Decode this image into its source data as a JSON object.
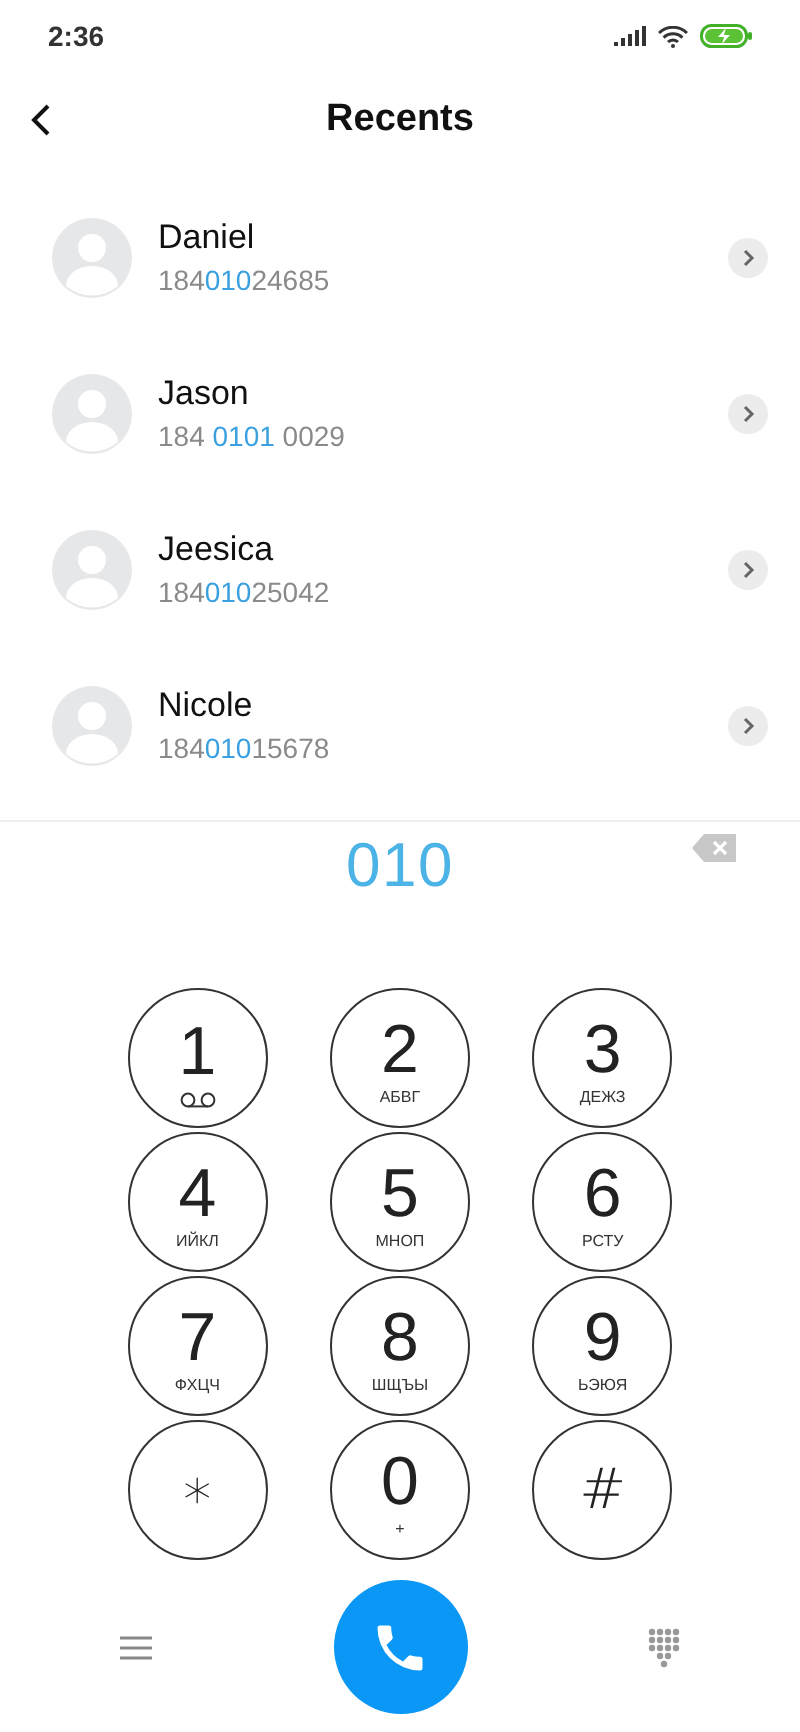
{
  "status_bar": {
    "time": "2:36"
  },
  "header": {
    "title": "Recents"
  },
  "contacts": [
    {
      "name": "Daniel",
      "number": [
        {
          "text": "184",
          "match": false
        },
        {
          "text": "010",
          "match": true
        },
        {
          "text": "24685",
          "match": false
        }
      ]
    },
    {
      "name": "Jason",
      "number": [
        {
          "text": "184 ",
          "match": false
        },
        {
          "text": "0101",
          "match": true
        },
        {
          "text": " 0029",
          "match": false
        }
      ]
    },
    {
      "name": "Jeesica",
      "number": [
        {
          "text": "184",
          "match": false
        },
        {
          "text": "010",
          "match": true
        },
        {
          "text": "25042",
          "match": false
        }
      ]
    },
    {
      "name": "Nicole",
      "number": [
        {
          "text": "184",
          "match": false
        },
        {
          "text": "010",
          "match": true
        },
        {
          "text": "15678",
          "match": false
        }
      ]
    }
  ],
  "dial_input": {
    "value": "010"
  },
  "keypad": [
    {
      "kind": "voicemail",
      "key": "1"
    },
    {
      "kind": "letters",
      "key": "2",
      "sub": "АБВГ"
    },
    {
      "kind": "letters",
      "key": "3",
      "sub": "ДЕЖЗ"
    },
    {
      "kind": "letters",
      "key": "4",
      "sub": "ИЙКЛ"
    },
    {
      "kind": "letters",
      "key": "5",
      "sub": "МНОП"
    },
    {
      "kind": "letters",
      "key": "6",
      "sub": "РСТУ"
    },
    {
      "kind": "letters",
      "key": "7",
      "sub": "ФХЦЧ"
    },
    {
      "kind": "letters",
      "key": "8",
      "sub": "ШЩЪЫ"
    },
    {
      "kind": "letters",
      "key": "9",
      "sub": "ЬЭЮЯ"
    },
    {
      "kind": "symbol",
      "key": "∗"
    },
    {
      "kind": "letters",
      "key": "0",
      "sub": "+"
    },
    {
      "kind": "symbol",
      "key": "#"
    }
  ]
}
